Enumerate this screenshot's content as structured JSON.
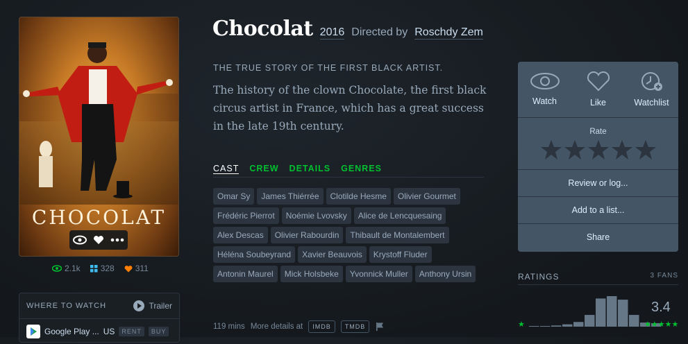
{
  "film": {
    "title": "Chocolat",
    "year": "2016",
    "directed_by_label": "Directed by",
    "director": "Roschdy Zem",
    "tagline": "THE TRUE STORY OF THE FIRST BLACK ARTIST.",
    "synopsis": "The history of the clown Chocolate, the first black circus artist in France, which has a great success in the late 19th century.",
    "runtime": "119 mins",
    "more_details_label": "More details at",
    "ext_links": [
      "IMDB",
      "TMDB"
    ]
  },
  "poster": {
    "title_text": "CHOCOLAT",
    "stats": {
      "watched": "2.1k",
      "lists": "328",
      "likes": "311"
    }
  },
  "tabs": [
    "CAST",
    "CREW",
    "DETAILS",
    "GENRES"
  ],
  "cast": [
    "Omar Sy",
    "James Thiérrée",
    "Clotilde Hesme",
    "Olivier Gourmet",
    "Frédéric Pierrot",
    "Noémie Lvovsky",
    "Alice de Lencquesaing",
    "Alex Descas",
    "Olivier Rabourdin",
    "Thibault de Montalembert",
    "Héléna Soubeyrand",
    "Xavier Beauvois",
    "Krystoff Fluder",
    "Antonin Maurel",
    "Mick Holsbeke",
    "Yvonnick Muller",
    "Anthony Ursin"
  ],
  "where_to_watch": {
    "title": "WHERE TO WATCH",
    "trailer_label": "Trailer",
    "service": "Google Play ...",
    "region": "US",
    "options": [
      "RENT",
      "BUY"
    ]
  },
  "panel": {
    "watch_label": "Watch",
    "like_label": "Like",
    "watchlist_label": "Watchlist",
    "rate_label": "Rate",
    "review_label": "Review or log...",
    "list_label": "Add to a list...",
    "share_label": "Share"
  },
  "ratings": {
    "title": "RATINGS",
    "fans": "3 FANS",
    "average": "3.4",
    "histogram": [
      1,
      1,
      2,
      4,
      8,
      20,
      48,
      52,
      46,
      20,
      7,
      6
    ],
    "min_label_stars": 1,
    "max_label_stars": 5
  },
  "colors": {
    "green": "#00c030",
    "blue": "#40bcf4",
    "orange": "#ff8000",
    "panel": "#445566"
  }
}
